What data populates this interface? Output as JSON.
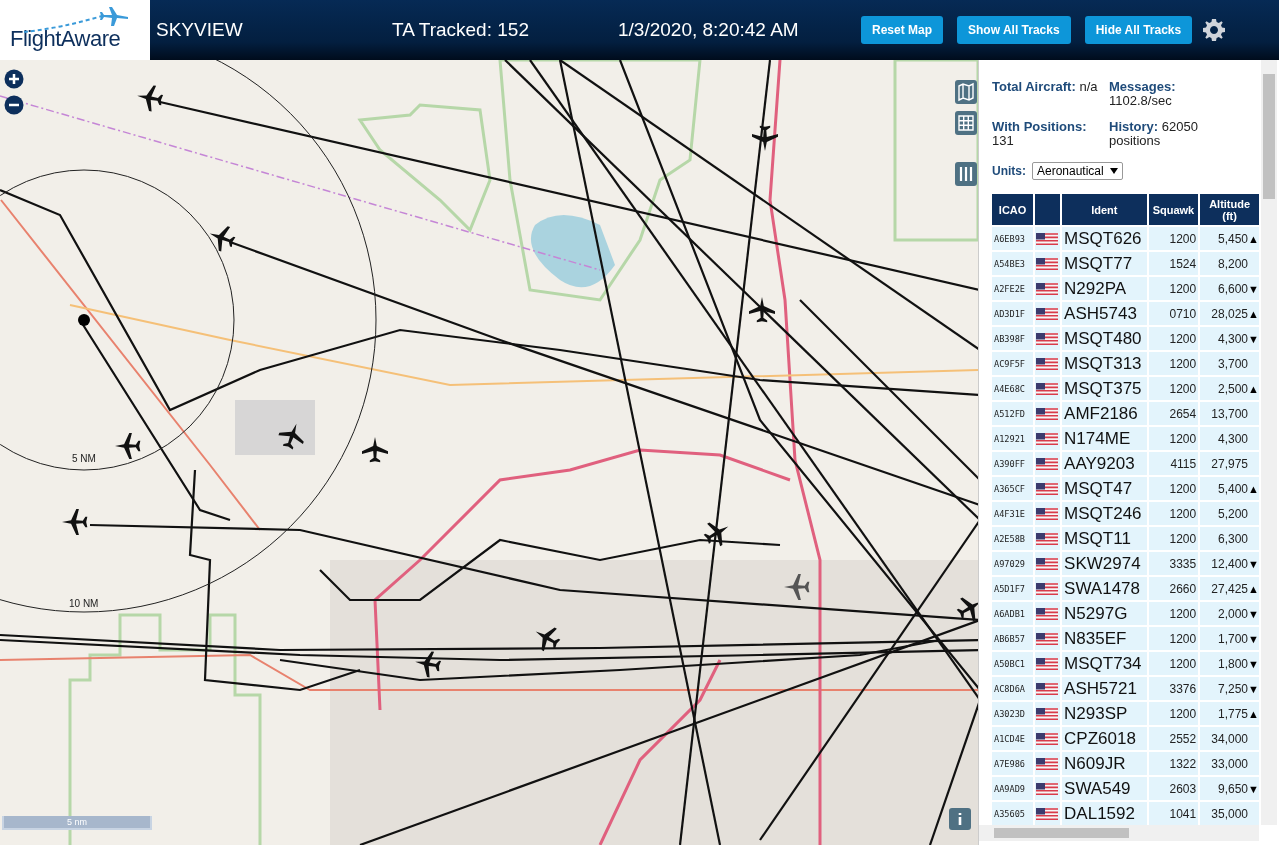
{
  "header": {
    "logo": "FlightAware",
    "title": "SKYVIEW",
    "tracked": "TA Tracked: 152",
    "datetime": "1/3/2020, 8:20:42 AM",
    "buttons": [
      "Reset Map",
      "Show All Tracks",
      "Hide All Tracks"
    ]
  },
  "map": {
    "range_rings": [
      "5 NM",
      "10 NM"
    ],
    "scale": "5 nm"
  },
  "stats": [
    {
      "text": "**Total Aircraft:** n/a"
    },
    {
      "text": "**Messages:** 1102.8/sec"
    },
    {
      "text": "**With Positions:** 131"
    },
    {
      "text": "**History:** 62050 positions"
    }
  ],
  "units": {
    "label": "Units:",
    "value": "Aeronautical"
  },
  "table": {
    "columns": [
      "ICAO",
      "Ident",
      "Squawk",
      "Altitude (ft)"
    ],
    "rows": [
      {
        "icao": "A6EB93",
        "ident": "MSQT626",
        "squawk": "1200",
        "altitude": "5,450",
        "trend": "▲"
      },
      {
        "icao": "A54BE3",
        "ident": "MSQT77",
        "squawk": "1524",
        "altitude": "8,200"
      },
      {
        "icao": "A2FE2E",
        "ident": "N292PA",
        "squawk": "1200",
        "altitude": "6,600",
        "trend": "▼"
      },
      {
        "icao": "AD3D1F",
        "ident": "ASH5743",
        "squawk": "0710",
        "altitude": "28,025",
        "trend": "▲"
      },
      {
        "icao": "AB398F",
        "ident": "MSQT480",
        "squawk": "1200",
        "altitude": "4,300",
        "trend": "▼"
      },
      {
        "icao": "AC9F5F",
        "ident": "MSQT313",
        "squawk": "1200",
        "altitude": "3,700"
      },
      {
        "icao": "A4E68C",
        "ident": "MSQT375",
        "squawk": "1200",
        "altitude": "2,500",
        "trend": "▲"
      },
      {
        "icao": "A512FD",
        "ident": "AMF2186",
        "squawk": "2654",
        "altitude": "13,700"
      },
      {
        "icao": "A12921",
        "ident": "N174ME",
        "squawk": "1200",
        "altitude": "4,300"
      },
      {
        "icao": "A390FF",
        "ident": "AAY9203",
        "squawk": "4115",
        "altitude": "27,975"
      },
      {
        "icao": "A365CF",
        "ident": "MSQT47",
        "squawk": "1200",
        "altitude": "5,400",
        "trend": "▲"
      },
      {
        "icao": "A4F31E",
        "ident": "MSQT246",
        "squawk": "1200",
        "altitude": "5,200"
      },
      {
        "icao": "A2E58B",
        "ident": "MSQT11",
        "squawk": "1200",
        "altitude": "6,300"
      },
      {
        "icao": "A97029",
        "ident": "SKW2974",
        "squawk": "3335",
        "altitude": "12,400",
        "trend": "▼"
      },
      {
        "icao": "A5D1F7",
        "ident": "SWA1478",
        "squawk": "2660",
        "altitude": "27,425",
        "trend": "▲"
      },
      {
        "icao": "A6ADB1",
        "ident": "N5297G",
        "squawk": "1200",
        "altitude": "2,000",
        "trend": "▼"
      },
      {
        "icao": "AB6B57",
        "ident": "N835EF",
        "squawk": "1200",
        "altitude": "1,700",
        "trend": "▼"
      },
      {
        "icao": "A50BC1",
        "ident": "MSQT734",
        "squawk": "1200",
        "altitude": "1,800",
        "trend": "▼"
      },
      {
        "icao": "AC8D6A",
        "ident": "ASH5721",
        "squawk": "3376",
        "altitude": "7,250",
        "trend": "▼"
      },
      {
        "icao": "A3023D",
        "ident": "N293SP",
        "squawk": "1200",
        "altitude": "1,775",
        "trend": "▲"
      },
      {
        "icao": "A1CD4E",
        "ident": "CPZ6018",
        "squawk": "2552",
        "altitude": "34,000"
      },
      {
        "icao": "A7E986",
        "ident": "N609JR",
        "squawk": "1322",
        "altitude": "33,000"
      },
      {
        "icao": "AA9AD9",
        "ident": "SWA549",
        "squawk": "2603",
        "altitude": "9,650",
        "trend": "▼"
      },
      {
        "icao": "A35605",
        "ident": "DAL1592",
        "squawk": "1041",
        "altitude": "35,000"
      }
    ]
  }
}
